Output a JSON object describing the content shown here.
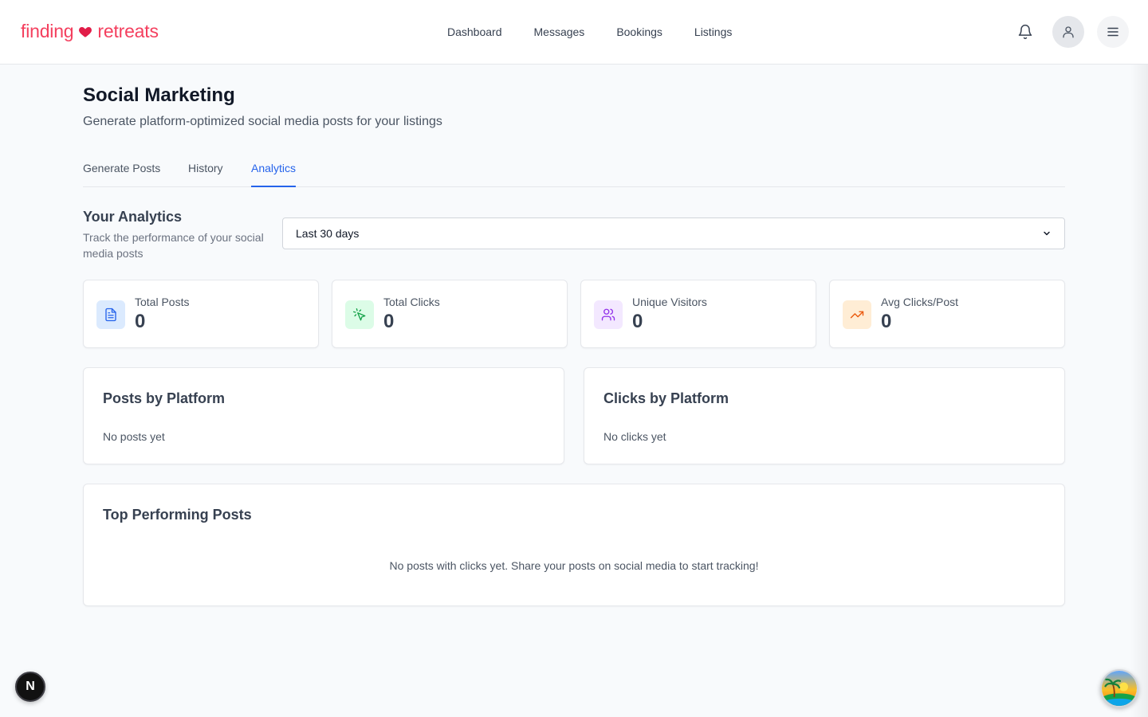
{
  "brand": {
    "name_left": "finding",
    "name_right": "retreats",
    "color": "#f43f5e"
  },
  "nav": [
    {
      "label": "Dashboard"
    },
    {
      "label": "Messages"
    },
    {
      "label": "Bookings"
    },
    {
      "label": "Listings"
    }
  ],
  "header_icons": [
    "bell-icon",
    "user-icon",
    "menu-icon"
  ],
  "page": {
    "title": "Social Marketing",
    "subtitle": "Generate platform-optimized social media posts for your listings"
  },
  "tabs": [
    {
      "label": "Generate Posts",
      "active": false
    },
    {
      "label": "History",
      "active": false
    },
    {
      "label": "Analytics",
      "active": true
    }
  ],
  "analytics": {
    "title": "Your Analytics",
    "description": "Track the performance of your social media posts",
    "range_selected": "Last 30 days"
  },
  "stats": [
    {
      "label": "Total Posts",
      "value": "0",
      "icon": "document-icon",
      "color": "#2563eb",
      "bg": "#dbeafe"
    },
    {
      "label": "Total Clicks",
      "value": "0",
      "icon": "cursor-click-icon",
      "color": "#16a34a",
      "bg": "#dcfce7"
    },
    {
      "label": "Unique Visitors",
      "value": "0",
      "icon": "users-icon",
      "color": "#9333ea",
      "bg": "#f3e8ff"
    },
    {
      "label": "Avg Clicks/Post",
      "value": "0",
      "icon": "trending-up-icon",
      "color": "#ea580c",
      "bg": "#ffedd5"
    }
  ],
  "panels": {
    "posts_by_platform": {
      "title": "Posts by Platform",
      "empty": "No posts yet"
    },
    "clicks_by_platform": {
      "title": "Clicks by Platform",
      "empty": "No clicks yet"
    },
    "top_posts": {
      "title": "Top Performing Posts",
      "empty": "No posts with clicks yet. Share your posts on social media to start tracking!"
    }
  },
  "floating": {
    "next_badge": "N"
  }
}
